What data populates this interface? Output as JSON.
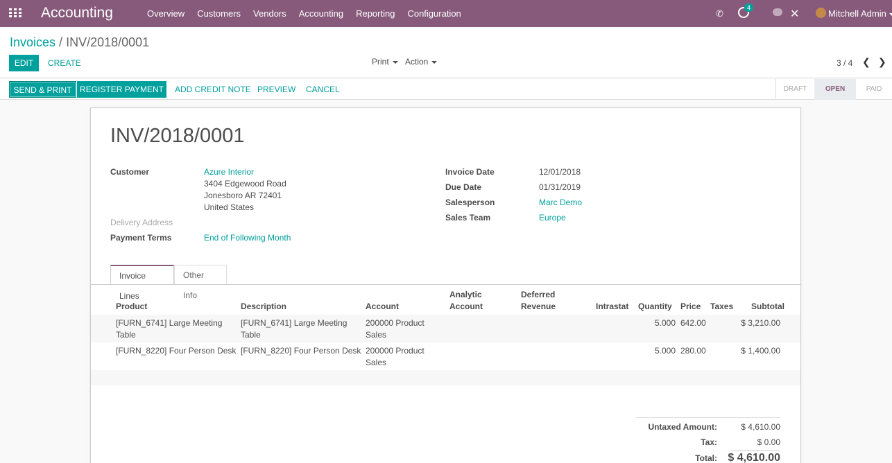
{
  "navbar": {
    "app_name": "Accounting",
    "menu": [
      "Overview",
      "Customers",
      "Vendors",
      "Accounting",
      "Reporting",
      "Configuration"
    ],
    "activity_count": "4",
    "user_name": "Mitchell Admin"
  },
  "breadcrumb": {
    "parent": "Invoices",
    "separator": " / ",
    "current": "INV/2018/0001"
  },
  "control": {
    "edit_label": "EDIT",
    "create_label": "CREATE",
    "print_label": "Print",
    "action_label": "Action",
    "pager": "3 / 4"
  },
  "statusbar": {
    "send_print": "SEND & PRINT",
    "register_payment": "REGISTER PAYMENT",
    "add_credit_note": "ADD CREDIT NOTE",
    "preview": "PREVIEW",
    "cancel": "CANCEL",
    "stages": [
      "DRAFT",
      "OPEN",
      "PAID"
    ],
    "active_stage": "OPEN"
  },
  "invoice": {
    "number": "INV/2018/0001",
    "customer_label": "Customer",
    "customer_name": "Azure Interior",
    "address_line1": "3404 Edgewood Road",
    "address_line2": "Jonesboro AR 72401",
    "address_line3": "United States",
    "delivery_address_label": "Delivery Address",
    "payment_terms_label": "Payment Terms",
    "payment_terms": "End of Following Month",
    "invoice_date_label": "Invoice Date",
    "invoice_date": "12/01/2018",
    "due_date_label": "Due Date",
    "due_date": "01/31/2019",
    "salesperson_label": "Salesperson",
    "salesperson": "Marc Demo",
    "sales_team_label": "Sales Team",
    "sales_team": "Europe"
  },
  "tabs": {
    "invoice_lines": "Invoice Lines",
    "other_info": "Other Info"
  },
  "table": {
    "headers": {
      "product": "Product",
      "description": "Description",
      "account": "Account",
      "analytic_1": "Analytic",
      "analytic_2": "Account",
      "deferred_1": "Deferred",
      "deferred_2": "Revenue",
      "intrastat": "Intrastat",
      "quantity": "Quantity",
      "price": "Price",
      "taxes": "Taxes",
      "subtotal": "Subtotal"
    },
    "rows": [
      {
        "product_1": "[FURN_6741] Large Meeting",
        "product_2": "Table",
        "description_1": "[FURN_6741] Large Meeting",
        "description_2": "Table",
        "account_1": "200000 Product",
        "account_2": "Sales",
        "quantity": "5.000",
        "price": "642.00",
        "subtotal": "$ 3,210.00"
      },
      {
        "product_1": "[FURN_8220] Four Person Desk",
        "product_2": "",
        "description_1": "[FURN_8220] Four Person Desk",
        "description_2": "",
        "account_1": "200000 Product",
        "account_2": "Sales",
        "quantity": "5.000",
        "price": "280.00",
        "subtotal": "$ 1,400.00"
      }
    ]
  },
  "totals": {
    "untaxed_label": "Untaxed Amount:",
    "untaxed_value": "$ 4,610.00",
    "tax_label": "Tax:",
    "tax_value": "$ 0.00",
    "total_label": "Total:",
    "total_value": "$ 4,610.00"
  },
  "colors": {
    "brand": "#875a7b",
    "accent": "#00a09d"
  }
}
